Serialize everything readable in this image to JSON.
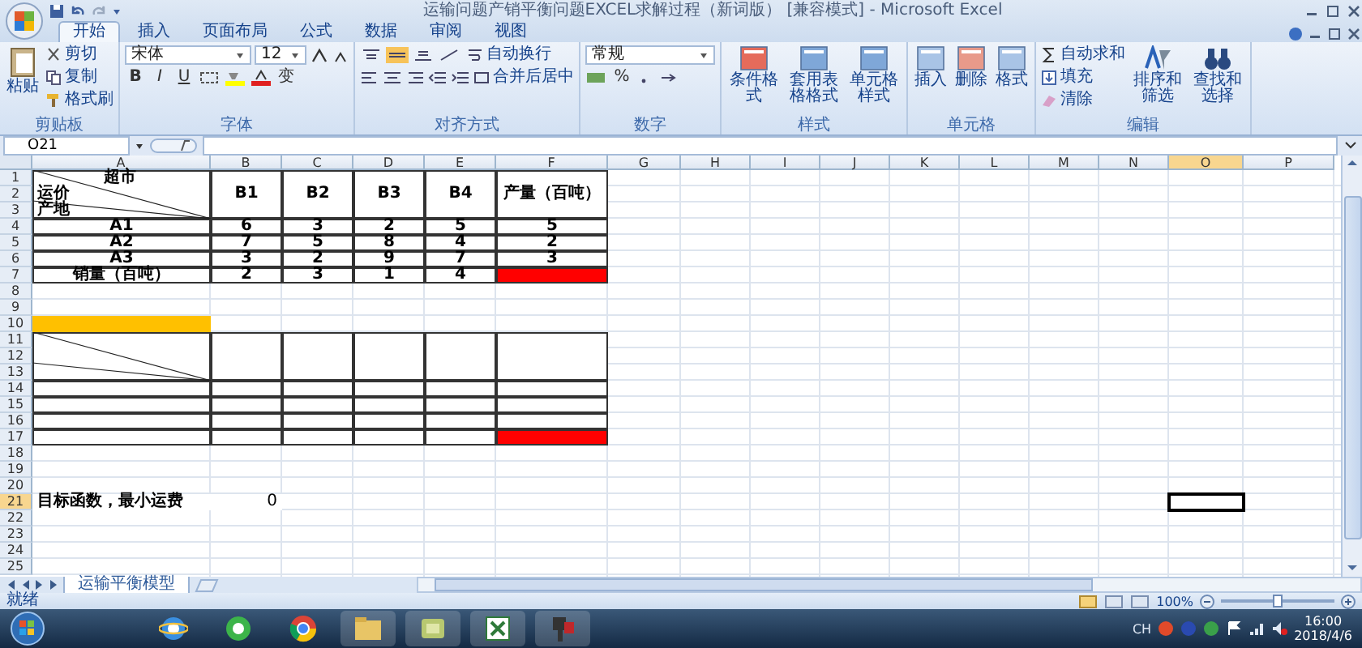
{
  "window": {
    "title": "运输问题产销平衡问题EXCEL求解过程（新词版） [兼容模式] - Microsoft Excel"
  },
  "ribbon_tabs": [
    {
      "label": "开始",
      "selected": true
    },
    {
      "label": "插入",
      "selected": false
    },
    {
      "label": "页面布局",
      "selected": false
    },
    {
      "label": "公式",
      "selected": false
    },
    {
      "label": "数据",
      "selected": false
    },
    {
      "label": "审阅",
      "selected": false
    },
    {
      "label": "视图",
      "selected": false
    }
  ],
  "clipboard": {
    "label": "剪贴板",
    "paste": "粘贴",
    "cut": "剪切",
    "copy": "复制",
    "painter": "格式刷"
  },
  "font": {
    "label": "字体",
    "family": "宋体",
    "size": "12",
    "bold": "B",
    "italic": "I",
    "underline": "U",
    "phonetic": "变"
  },
  "alignment": {
    "label": "对齐方式",
    "wrap": "自动换行",
    "merge": "合并后居中"
  },
  "number": {
    "label": "数字",
    "format": "常规",
    "percent": "%"
  },
  "styles": {
    "label": "样式",
    "buttons": [
      "条件格式",
      "套用表格格式",
      "单元格样式"
    ]
  },
  "cells": {
    "label": "单元格",
    "buttons": [
      "插入",
      "删除",
      "格式"
    ]
  },
  "editing": {
    "label": "编辑",
    "small": [
      "自动求和",
      "填充",
      "清除"
    ],
    "big": [
      "排序和筛选",
      "查找和选择"
    ]
  },
  "name_box": "O21",
  "sheet": {
    "columns": [
      {
        "label": "A",
        "selected": false
      },
      {
        "label": "B",
        "selected": false
      },
      {
        "label": "C",
        "selected": false
      },
      {
        "label": "D",
        "selected": false
      },
      {
        "label": "E",
        "selected": false
      },
      {
        "label": "F",
        "selected": false
      },
      {
        "label": "G",
        "selected": false
      },
      {
        "label": "H",
        "selected": false
      },
      {
        "label": "I",
        "selected": false
      },
      {
        "label": "J",
        "selected": false
      },
      {
        "label": "K",
        "selected": false
      },
      {
        "label": "L",
        "selected": false
      },
      {
        "label": "M",
        "selected": false
      },
      {
        "label": "N",
        "selected": false
      },
      {
        "label": "O",
        "selected": true
      },
      {
        "label": "P",
        "selected": false
      }
    ],
    "rows": [
      {
        "label": "1",
        "selected": false,
        "cells": [
          {
            "kind": "diagonal",
            "rowspan": 3,
            "border": true,
            "bold": true,
            "top": "超市",
            "middle": "运价",
            "bottom": "产地"
          },
          {
            "text": "B1",
            "rowspan": 3,
            "border": true,
            "bold": true
          },
          {
            "text": "B2",
            "rowspan": 3,
            "border": true,
            "bold": true
          },
          {
            "text": "B3",
            "rowspan": 3,
            "border": true,
            "bold": true
          },
          {
            "text": "B4",
            "rowspan": 3,
            "border": true,
            "bold": true
          },
          {
            "text": "产量（百吨）",
            "rowspan": 3,
            "border": true,
            "bold": true
          }
        ]
      },
      {
        "label": "2",
        "selected": false
      },
      {
        "label": "3",
        "selected": false
      },
      {
        "label": "4",
        "selected": false,
        "cells": [
          {
            "text": "A1",
            "border": true,
            "bold": true
          },
          {
            "text": "6",
            "border": true,
            "bold": true
          },
          {
            "text": "3",
            "border": true,
            "bold": true
          },
          {
            "text": "2",
            "border": true,
            "bold": true
          },
          {
            "text": "5",
            "border": true,
            "bold": true
          },
          {
            "text": "5",
            "border": true,
            "bold": true
          }
        ]
      },
      {
        "label": "5",
        "selected": false,
        "cells": [
          {
            "text": "A2",
            "border": true,
            "bold": true
          },
          {
            "text": "7",
            "border": true,
            "bold": true
          },
          {
            "text": "5",
            "border": true,
            "bold": true
          },
          {
            "text": "8",
            "border": true,
            "bold": true
          },
          {
            "text": "4",
            "border": true,
            "bold": true
          },
          {
            "text": "2",
            "border": true,
            "bold": true
          }
        ]
      },
      {
        "label": "6",
        "selected": false,
        "cells": [
          {
            "text": "A3",
            "border": true,
            "bold": true
          },
          {
            "text": "3",
            "border": true,
            "bold": true
          },
          {
            "text": "2",
            "border": true,
            "bold": true
          },
          {
            "text": "9",
            "border": true,
            "bold": true
          },
          {
            "text": "7",
            "border": true,
            "bold": true
          },
          {
            "text": "3",
            "border": true,
            "bold": true
          }
        ]
      },
      {
        "label": "7",
        "selected": false,
        "cells": [
          {
            "text": "销量（百吨）",
            "border": true,
            "bold": true
          },
          {
            "text": "2",
            "border": true,
            "bold": true
          },
          {
            "text": "3",
            "border": true,
            "bold": true
          },
          {
            "text": "1",
            "border": true,
            "bold": true
          },
          {
            "text": "4",
            "border": true,
            "bold": true
          },
          {
            "border": true,
            "color": "#ff0000"
          }
        ]
      },
      {
        "label": "8",
        "selected": false
      },
      {
        "label": "9",
        "selected": false
      },
      {
        "label": "10",
        "selected": false,
        "cells": [
          {
            "color": "#ffc000"
          }
        ]
      },
      {
        "label": "11",
        "selected": false,
        "cells": [
          {
            "kind": "diagonal",
            "rowspan": 3,
            "border": true
          },
          {
            "rowspan": 3,
            "border": true
          },
          {
            "rowspan": 3,
            "border": true
          },
          {
            "rowspan": 3,
            "border": true
          },
          {
            "rowspan": 3,
            "border": true
          },
          {
            "rowspan": 3,
            "border": true
          }
        ]
      },
      {
        "label": "12",
        "selected": false
      },
      {
        "label": "13",
        "selected": false
      },
      {
        "label": "14",
        "selected": false,
        "cells": [
          {
            "border": true
          },
          {
            "border": true
          },
          {
            "border": true
          },
          {
            "border": true
          },
          {
            "border": true
          },
          {
            "border": true
          }
        ]
      },
      {
        "label": "15",
        "selected": false,
        "cells": [
          {
            "border": true
          },
          {
            "border": true
          },
          {
            "border": true
          },
          {
            "border": true
          },
          {
            "border": true
          },
          {
            "border": true
          }
        ]
      },
      {
        "label": "16",
        "selected": false,
        "cells": [
          {
            "border": true
          },
          {
            "border": true
          },
          {
            "border": true
          },
          {
            "border": true
          },
          {
            "border": true
          },
          {
            "border": true
          }
        ]
      },
      {
        "label": "17",
        "selected": false,
        "cells": [
          {
            "border": true
          },
          {
            "border": true
          },
          {
            "border": true
          },
          {
            "border": true
          },
          {
            "border": true
          },
          {
            "border": true,
            "color": "#ff0000"
          }
        ]
      },
      {
        "label": "18",
        "selected": false
      },
      {
        "label": "19",
        "selected": false
      },
      {
        "label": "20",
        "selected": false
      },
      {
        "label": "21",
        "selected": true,
        "cells": [
          {
            "text": "目标函数，最小运费",
            "bold": true,
            "kind": "label"
          },
          {
            "text": "0",
            "kind": "value"
          }
        ]
      },
      {
        "label": "22",
        "selected": false
      },
      {
        "label": "23",
        "selected": false
      },
      {
        "label": "24",
        "selected": false
      },
      {
        "label": "25",
        "selected": false
      }
    ]
  },
  "sheet_tabs": [
    {
      "label": "运输平衡模型",
      "selected": true
    }
  ],
  "status": {
    "text": "就绪",
    "zoom": "100%",
    "zoom_slider": {
      "level": 0.5
    }
  },
  "taskbar": {
    "apps": [
      {
        "kind": "ie"
      },
      {
        "kind": "browser"
      },
      {
        "kind": "chrome"
      },
      {
        "kind": "folder"
      },
      {
        "kind": "app"
      },
      {
        "kind": "excel"
      },
      {
        "kind": "camera"
      }
    ],
    "input": "CH",
    "time": "16:00",
    "date": "2018/4/6"
  }
}
